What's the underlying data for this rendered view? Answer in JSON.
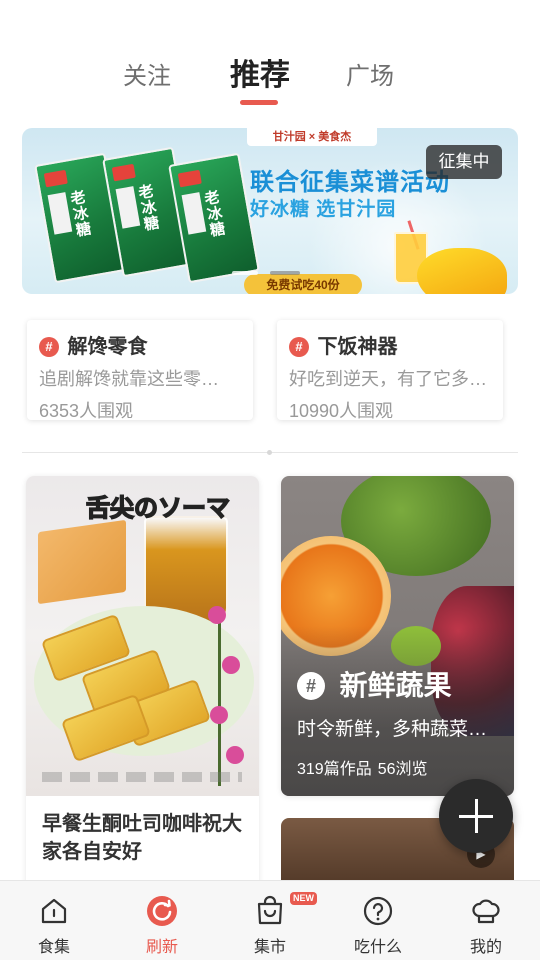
{
  "top_tabs": [
    {
      "label": "关注",
      "active": false
    },
    {
      "label": "推荐",
      "active": true
    },
    {
      "label": "广场",
      "active": false
    }
  ],
  "banner": {
    "brand": "甘汁园 × 美食杰",
    "headline": "联合征集菜谱活动",
    "subline": "好冰糖 选甘汁园",
    "packet_text": "老冰糖",
    "trial": "免费试吃40份",
    "badge": "征集中"
  },
  "topics": [
    {
      "title": "解馋零食",
      "desc": "追剧解馋就靠这些零…",
      "count": "6353人围观"
    },
    {
      "title": "下饭神器",
      "desc": "好吃到逆天，有了它多…",
      "count": "10990人围观"
    }
  ],
  "feed": {
    "left_card": {
      "image_caption": "舌尖のソーマ",
      "title": "早餐生酮吐司咖啡祝大家各自安好"
    },
    "right_card": {
      "title": "新鲜蔬果",
      "desc": "时令新鲜，多种蔬菜…",
      "works": "319篇作品",
      "views": "56浏览"
    }
  },
  "bottom_nav": [
    {
      "label": "食集",
      "icon": "home-icon",
      "active": false
    },
    {
      "label": "刷新",
      "icon": "refresh-icon",
      "active": true
    },
    {
      "label": "集市",
      "icon": "shopping-bag-icon",
      "active": false,
      "badge": "NEW"
    },
    {
      "label": "吃什么",
      "icon": "question-icon",
      "active": false
    },
    {
      "label": "我的",
      "icon": "chef-hat-icon",
      "active": false
    }
  ],
  "colors": {
    "accent": "#e85a4f",
    "text_dark": "#333333",
    "text_muted": "#999999",
    "fab": "#2b2b2b"
  }
}
